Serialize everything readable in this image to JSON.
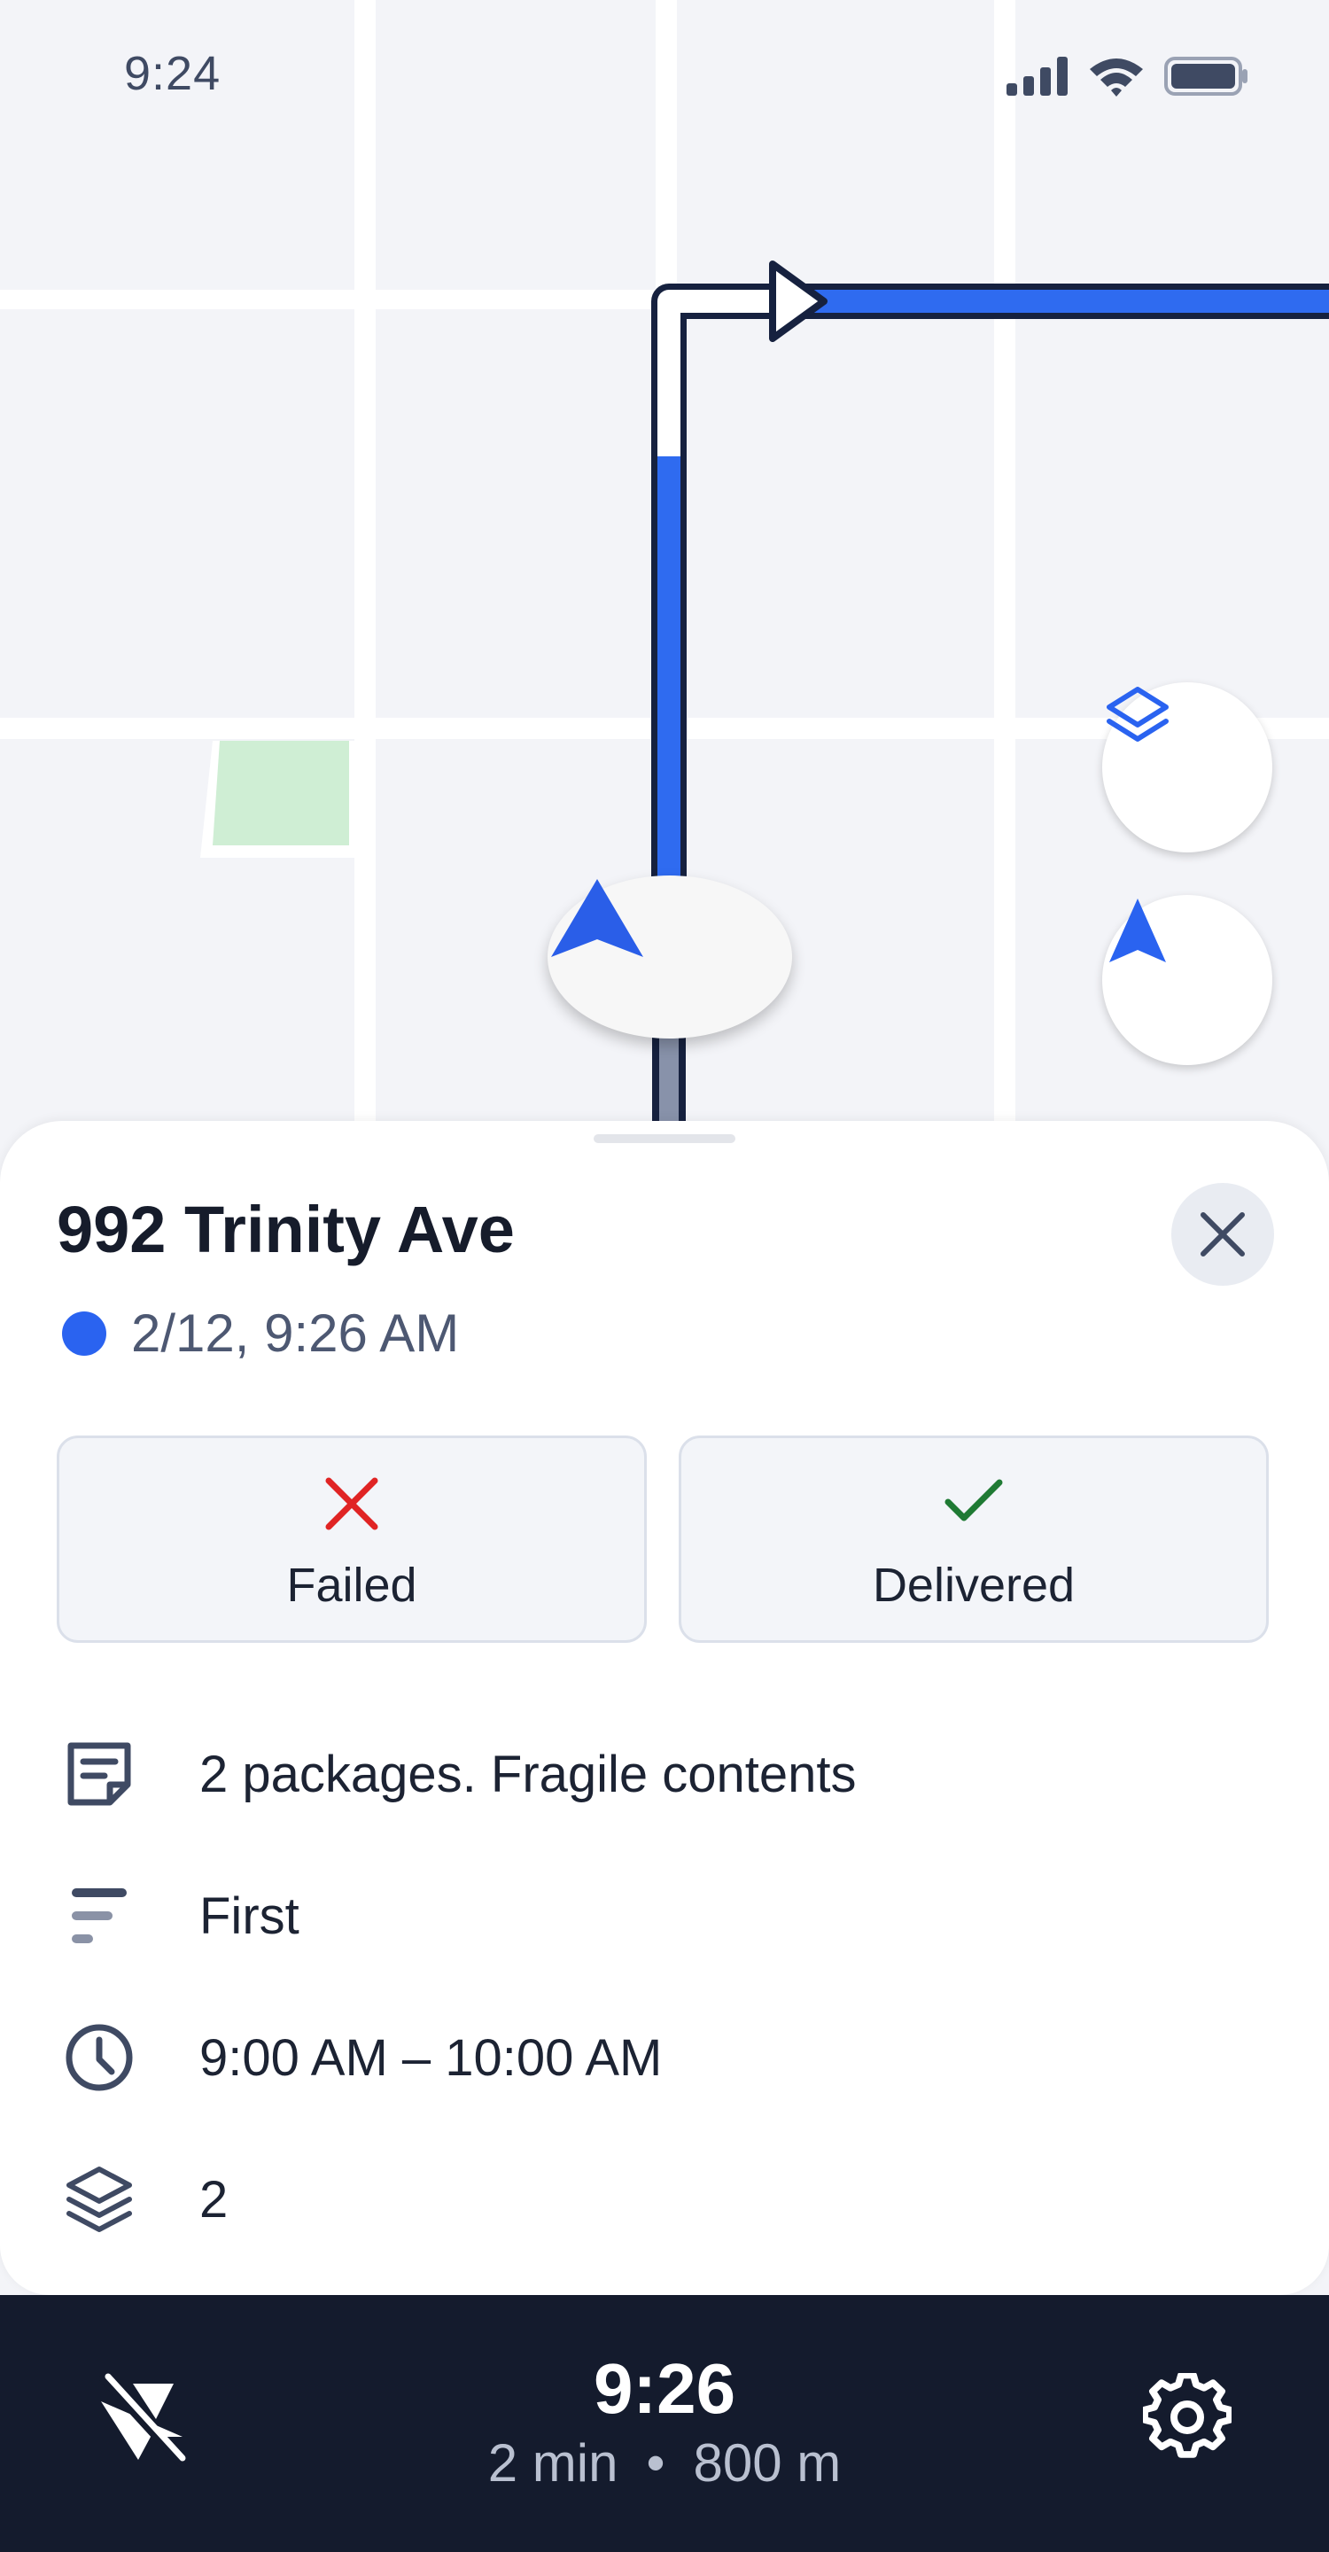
{
  "status_bar": {
    "time": "9:24"
  },
  "map": {
    "route_color": "#2f6bf0",
    "route_border": "#16213f",
    "park_color": "#cfeed4"
  },
  "stop": {
    "address": "992 Trinity Ave",
    "eta": "2/12, 9:26 AM",
    "eta_dot_color": "#2a63f0",
    "actions": {
      "failed_label": "Failed",
      "failed_color": "#e02424",
      "delivered_label": "Delivered",
      "delivered_color": "#1f7a34"
    },
    "details": {
      "note": "2 packages. Fragile contents",
      "priority": "First",
      "time_window": "9:00 AM – 10:00 AM",
      "packages": "2"
    }
  },
  "bottom_bar": {
    "arrival_time": "9:26",
    "duration": "2 min",
    "separator": "•",
    "distance": "800 m"
  }
}
